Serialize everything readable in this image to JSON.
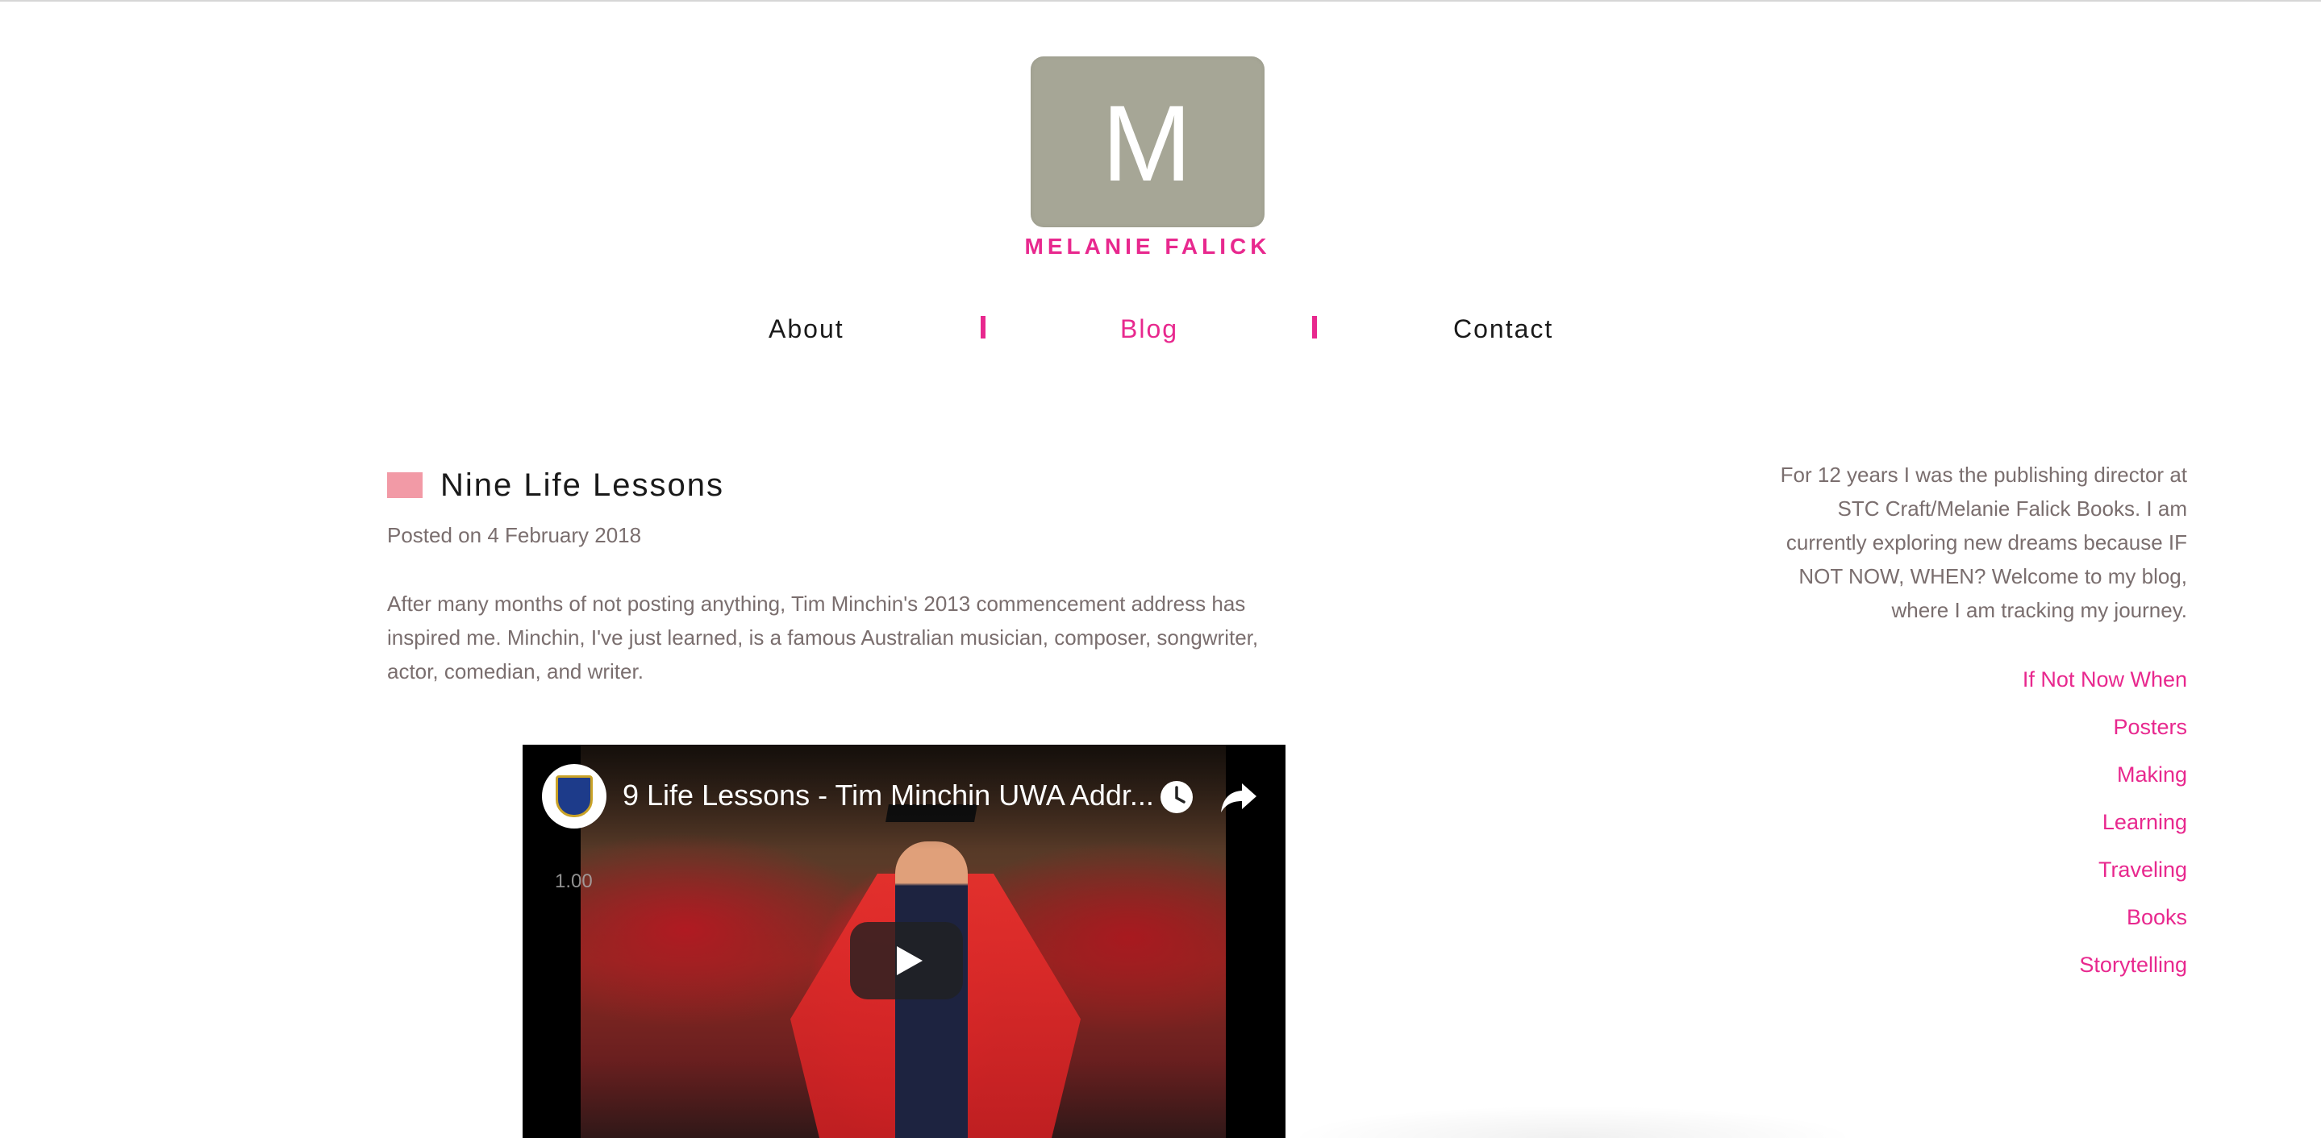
{
  "site": {
    "logo_letter": "M",
    "name": "MELANIE FALICK"
  },
  "nav": {
    "items": [
      {
        "label": "About"
      },
      {
        "label": "Blog"
      },
      {
        "label": "Contact"
      }
    ],
    "active": "Blog"
  },
  "post": {
    "title": "Nine Life Lessons",
    "meta": "Posted on 4 February 2018",
    "body": "After many months of not posting anything, Tim Minchin's 2013 commencement address has inspired me.  Minchin, I've just learned, is a famous Australian musician, composer, songwriter, actor, comedian, and writer."
  },
  "video": {
    "title": "9 Life Lessons - Tim Minchin UWA Addr...",
    "speed": "1.00",
    "icons": [
      "watch-later-icon",
      "share-icon",
      "play-icon"
    ]
  },
  "sidebar": {
    "intro": "For 12 years I was the publishing director at STC Craft/Melanie Falick Books. I am currently exploring new dreams because IF NOT NOW, WHEN? Welcome to my blog, where I am tracking my journey.",
    "categories": [
      {
        "label": "If Not Now When"
      },
      {
        "label": "Posters"
      },
      {
        "label": "Making"
      },
      {
        "label": "Learning"
      },
      {
        "label": "Traveling"
      },
      {
        "label": "Books"
      },
      {
        "label": "Storytelling"
      }
    ]
  },
  "colors": {
    "accent": "#e8288e",
    "logo_bg": "#a6a696",
    "post_marker": "#f29aa6",
    "body_text": "#7a6e6e"
  }
}
